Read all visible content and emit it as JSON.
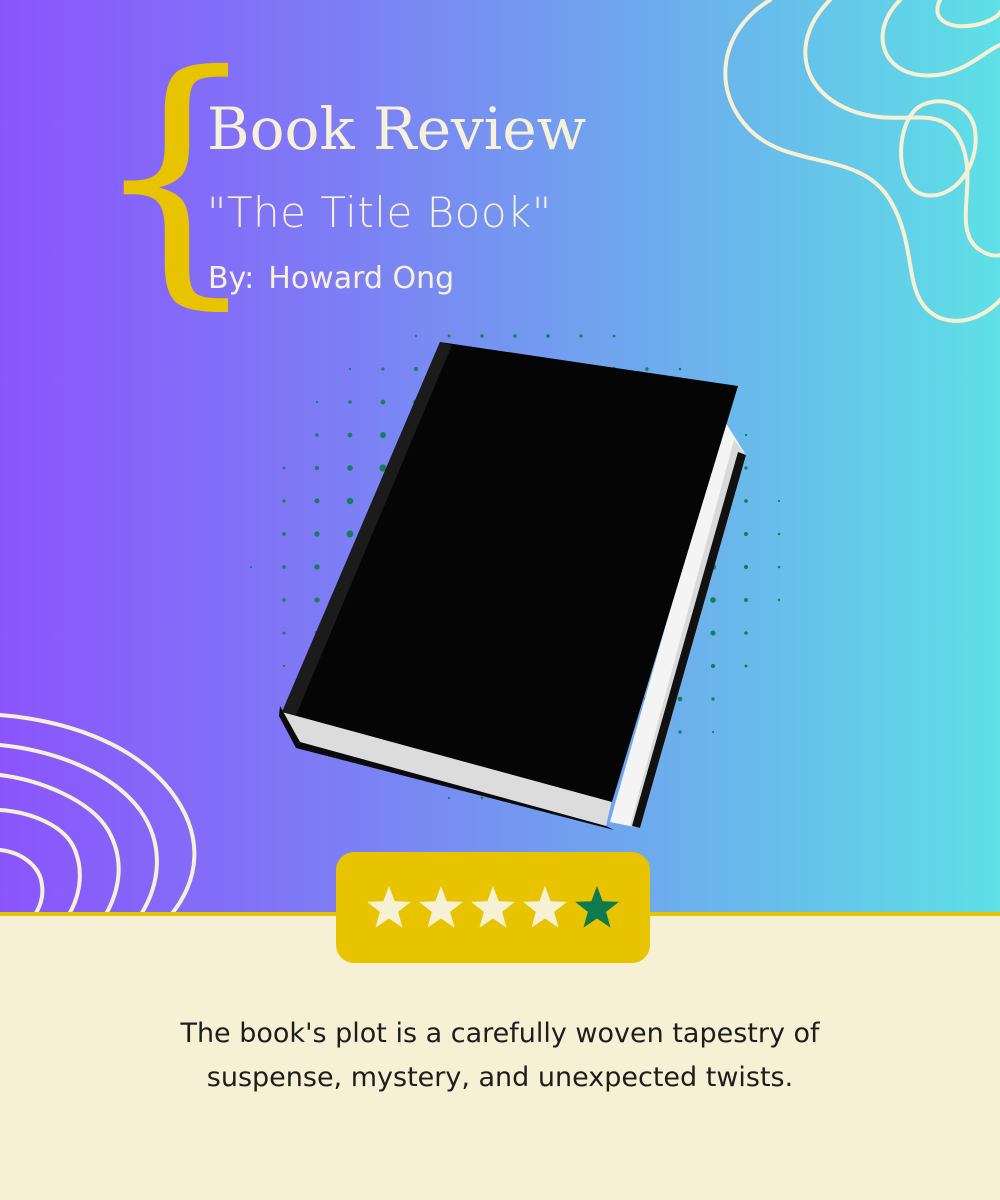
{
  "header": {
    "title": "Book Review",
    "book_title": "\"The Title Book\"",
    "author_label": "By:",
    "author_name": "Howard Ong"
  },
  "rating": {
    "value": 4,
    "max": 5,
    "filled_color": "#f6f1d4",
    "empty_color": "#0f7a4f",
    "badge_color": "#e8c300"
  },
  "review": {
    "line1": "The book's plot is a carefully woven tapestry of",
    "line2": "suspense, mystery, and unexpected twists."
  },
  "colors": {
    "gradient_start": "#8b55fc",
    "gradient_end": "#5ee0e6",
    "accent": "#e8c300",
    "cream": "#f6f1d4",
    "dot_green": "#13805a",
    "book": "#050505"
  }
}
